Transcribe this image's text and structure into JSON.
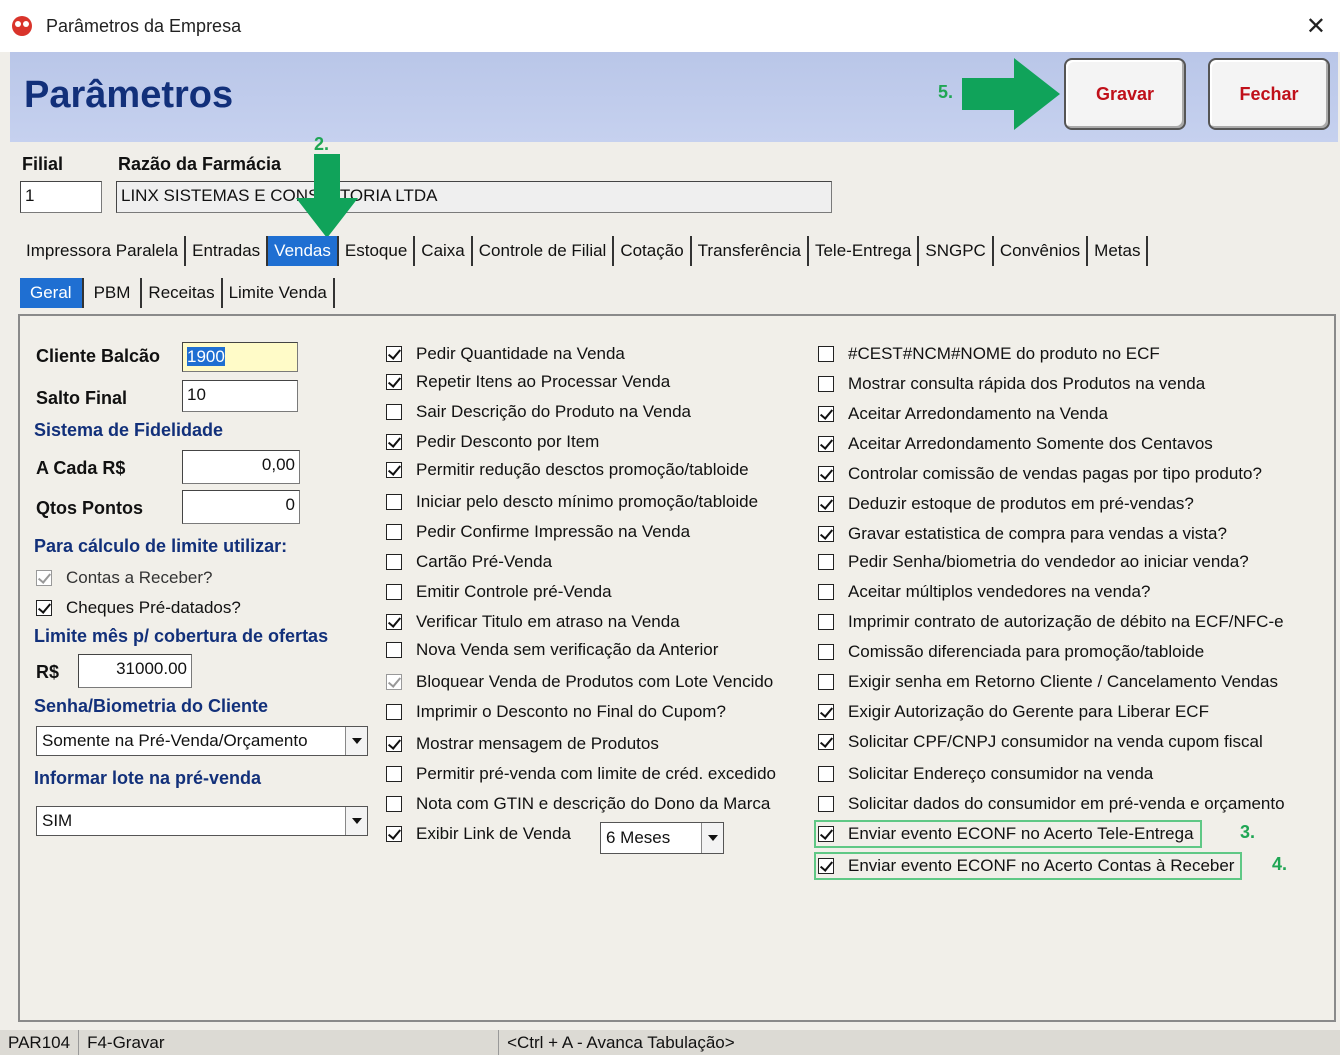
{
  "window": {
    "title": "Parâmetros da Empresa"
  },
  "header": {
    "title": "Parâmetros",
    "gravar_label": "Gravar",
    "fechar_label": "Fechar"
  },
  "annotations": {
    "step2": "2.",
    "step3": "3.",
    "step4": "4.",
    "step5": "5."
  },
  "filial": {
    "label": "Filial",
    "value": "1"
  },
  "razao": {
    "label": "Razão da Farmácia",
    "value": "LINX SISTEMAS E CONSULTORIA LTDA"
  },
  "tabs_main": [
    "Impressora Paralela",
    "Entradas",
    "Vendas",
    "Estoque",
    "Caixa",
    "Controle de Filial",
    "Cotação",
    "Transferência",
    "Tele-Entrega",
    "SNGPC",
    "Convênios",
    "Metas"
  ],
  "tabs_sub": [
    "Geral",
    "PBM",
    "Receitas",
    "Limite Venda"
  ],
  "left": {
    "cliente_balcao_label": "Cliente Balcão",
    "cliente_balcao_value": "1900",
    "salto_final_label": "Salto Final",
    "salto_final_value": "10",
    "fidelidade_head": "Sistema de Fidelidade",
    "a_cada_label": "A Cada R$",
    "a_cada_value": "0,00",
    "qtos_pontos_label": "Qtos Pontos",
    "qtos_pontos_value": "0",
    "calculo_head": "Para cálculo de limite utilizar:",
    "contas_receber": "Contas a Receber?",
    "cheques": "Cheques Pré-datados?",
    "limite_head": "Limite mês p/ cobertura de ofertas",
    "rs_label": "R$",
    "rs_value": "31000.00",
    "senha_head": "Senha/Biometria do Cliente",
    "senha_value": "Somente na Pré-Venda/Orçamento",
    "lote_head": "Informar lote na pré-venda",
    "lote_value": "SIM"
  },
  "middle": {
    "items": [
      "Pedir Quantidade na Venda",
      "Repetir Itens ao Processar Venda",
      "Sair Descrição do Produto na Venda",
      "Pedir Desconto por Item",
      "Permitir redução desctos promoção/tabloide",
      "Iniciar pelo descto mínimo promoção/tabloide",
      "Pedir Confirme Impressão na Venda",
      "Cartão Pré-Venda",
      "Emitir Controle pré-Venda",
      "Verificar Titulo em atraso na Venda",
      "Nova Venda sem verificação da Anterior",
      "Bloquear Venda de Produtos com Lote Vencido",
      "Imprimir o Desconto no Final do Cupom?",
      "Mostrar mensagem de Produtos",
      "Permitir pré-venda com limite de créd. excedido",
      "Nota com GTIN e descrição do Dono da Marca",
      "Exibir Link de Venda"
    ],
    "link_venda_value": "6 Meses"
  },
  "right": {
    "items": [
      "#CEST#NCM#NOME do produto no ECF",
      "Mostrar consulta rápida dos Produtos na venda",
      "Aceitar Arredondamento na Venda",
      "Aceitar Arredondamento Somente dos Centavos",
      "Controlar comissão de vendas pagas por tipo produto?",
      "Deduzir estoque de produtos em pré-vendas?",
      "Gravar estatistica de compra para vendas a vista?",
      "Pedir Senha/biometria do vendedor ao iniciar venda?",
      "Aceitar múltiplos vendedores na venda?",
      "Imprimir contrato de autorização de débito na ECF/NFC-e",
      "Comissão diferenciada para promoção/tabloide",
      "Exigir senha em Retorno Cliente / Cancelamento Vendas",
      "Exigir Autorização do Gerente para Liberar ECF",
      "Solicitar CPF/CNPJ consumidor na venda cupom fiscal",
      "Solicitar Endereço consumidor na venda",
      "Solicitar dados do consumidor em pré-venda e orçamento",
      "Enviar evento ECONF no Acerto Tele-Entrega",
      "Enviar evento ECONF no Acerto Contas à Receber"
    ]
  },
  "status": {
    "code": "PAR104",
    "hint": "F4-Gravar",
    "tab_hint": "<Ctrl + A - Avanca Tabulação>"
  },
  "colors": {
    "header_blue": "#12307a",
    "annot_green": "#1fa654",
    "button_red": "#c0101a",
    "tab_active": "#1f6fd2"
  }
}
